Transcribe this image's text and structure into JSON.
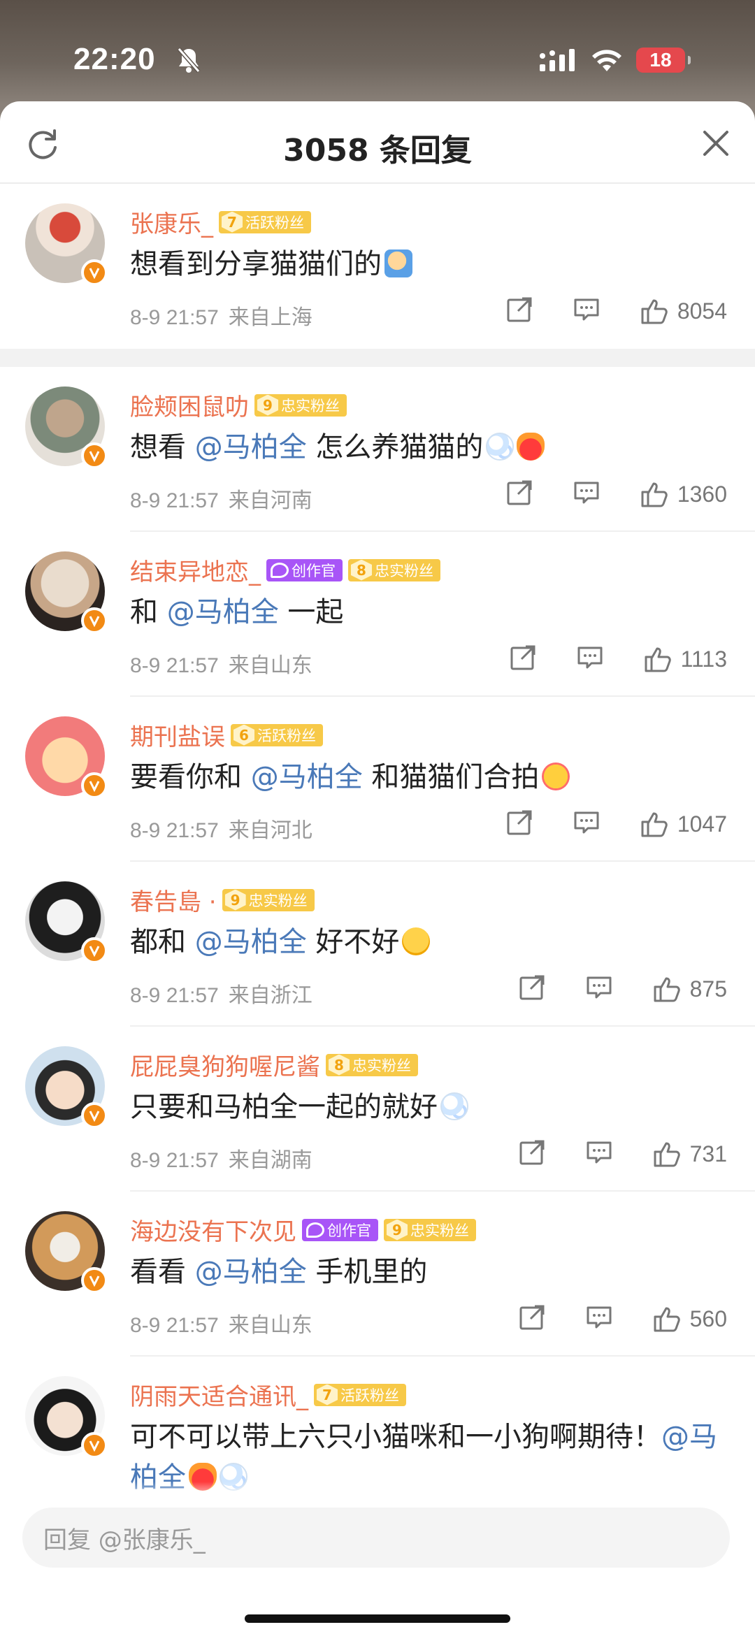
{
  "status": {
    "time": "22:20",
    "battery": "18"
  },
  "header": {
    "title": "3058 条回复"
  },
  "pinned": {
    "name": "张康乐_",
    "badge_level": "7",
    "badge_text": "活跃粉丝",
    "text": "想看到分享猫猫们的",
    "time": "8-9 21:57",
    "loc": "来自上海",
    "likes": "8054"
  },
  "comments": [
    {
      "name": "脸颊困鼠叻",
      "badge_level": "9",
      "badge_text": "忠实粉丝",
      "text_pre": "想看 ",
      "mention": "@马柏全",
      "text_post": " 怎么养猫猫的",
      "time": "8-9 21:57",
      "loc": "来自河南",
      "likes": "1360"
    },
    {
      "name": "结束异地恋_",
      "creator": "创作官",
      "badge_level": "8",
      "badge_text": "忠实粉丝",
      "text_pre": "和 ",
      "mention": "@马柏全",
      "text_post": " 一起",
      "time": "8-9 21:57",
      "loc": "来自山东",
      "likes": "1113"
    },
    {
      "name": "期刊盐误",
      "badge_level": "6",
      "badge_text": "活跃粉丝",
      "text_pre": "要看你和 ",
      "mention": "@马柏全",
      "text_post": " 和猫猫们合拍",
      "time": "8-9 21:57",
      "loc": "来自河北",
      "likes": "1047"
    },
    {
      "name": "春告島 ·",
      "badge_level": "9",
      "badge_text": "忠实粉丝",
      "text_pre": "都和 ",
      "mention": "@马柏全",
      "text_post": " 好不好",
      "time": "8-9 21:57",
      "loc": "来自浙江",
      "likes": "875"
    },
    {
      "name": "屁屁臭狗狗喔尼酱",
      "badge_level": "8",
      "badge_text": "忠实粉丝",
      "text_pre": "只要和马柏全一起的就好",
      "mention": "",
      "text_post": "",
      "time": "8-9 21:57",
      "loc": "来自湖南",
      "likes": "731"
    },
    {
      "name": "海边没有下次见",
      "creator": "创作官",
      "badge_level": "9",
      "badge_text": "忠实粉丝",
      "text_pre": "看看 ",
      "mention": "@马柏全",
      "text_post": " 手机里的",
      "time": "8-9 21:57",
      "loc": "来自山东",
      "likes": "560"
    },
    {
      "name": "阴雨天适合通讯_",
      "badge_level": "7",
      "badge_text": "活跃粉丝",
      "text_pre": "可不可以带上六只小猫咪和一小狗啊期待！",
      "mention": "@马柏全",
      "text_post": ""
    }
  ],
  "reply": {
    "placeholder": "回复 @张康乐_"
  },
  "colors": {
    "username": "#eb7350",
    "mention": "#4a79b8",
    "badge": "#f7c948",
    "creator": "#a855f7"
  }
}
